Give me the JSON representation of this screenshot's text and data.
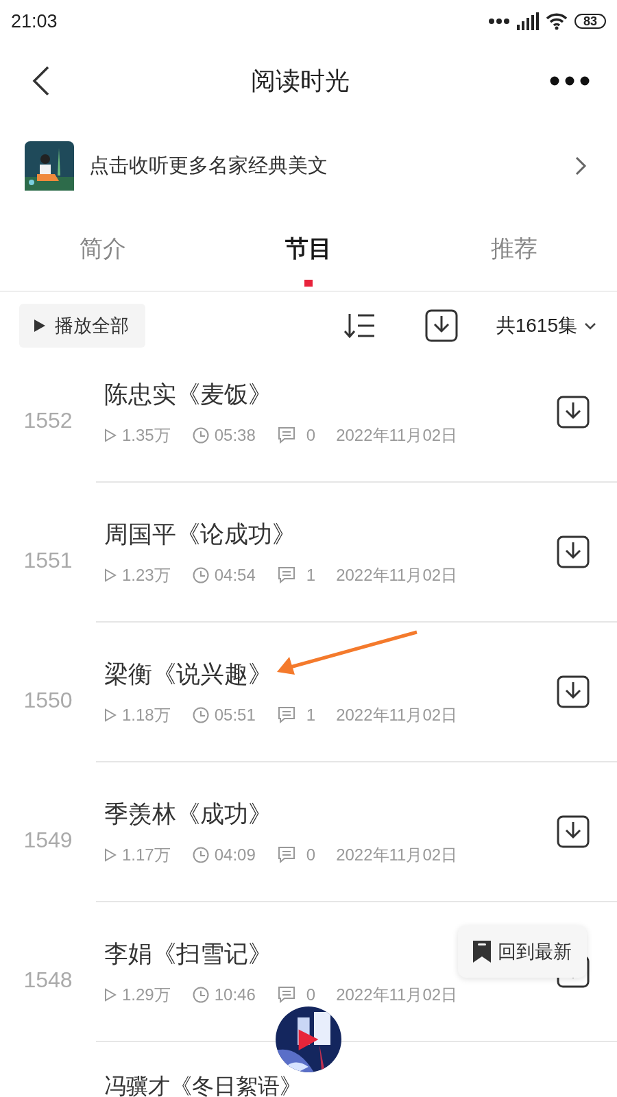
{
  "status_bar": {
    "time": "21:03",
    "battery": "83"
  },
  "header": {
    "title": "阅读时光"
  },
  "banner": {
    "text": "点击收听更多名家经典美文"
  },
  "tabs": [
    {
      "label": "简介",
      "selected": false
    },
    {
      "label": "节目",
      "selected": true
    },
    {
      "label": "推荐",
      "selected": false
    }
  ],
  "toolbar": {
    "play_all": "播放全部",
    "count": "共1615集"
  },
  "episodes": [
    {
      "number": "1552",
      "title": "陈忠实《麦饭》",
      "plays": "1.35万",
      "duration": "05:38",
      "comments": "0",
      "date": "2022年11月02日"
    },
    {
      "number": "1551",
      "title": "周国平《论成功》",
      "plays": "1.23万",
      "duration": "04:54",
      "comments": "1",
      "date": "2022年11月02日"
    },
    {
      "number": "1550",
      "title": "梁衡《说兴趣》",
      "plays": "1.18万",
      "duration": "05:51",
      "comments": "1",
      "date": "2022年11月02日"
    },
    {
      "number": "1549",
      "title": "季羡林《成功》",
      "plays": "1.17万",
      "duration": "04:09",
      "comments": "0",
      "date": "2022年11月02日"
    },
    {
      "number": "1548",
      "title": "李娟《扫雪记》",
      "plays": "1.29万",
      "duration": "10:46",
      "comments": "0",
      "date": "2022年11月02日"
    }
  ],
  "partial_episode": {
    "title": "冯骥才《冬日絮语》"
  },
  "back_to_latest": {
    "label": "回到最新"
  }
}
